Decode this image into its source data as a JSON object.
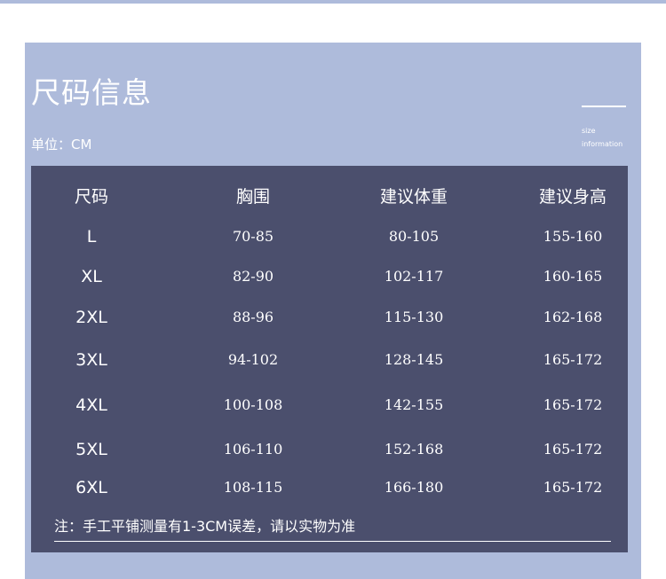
{
  "title": "尺码信息",
  "unit": "单位：CM",
  "deco": {
    "line1": "size",
    "line2": "information"
  },
  "table": {
    "headers": [
      "尺码",
      "胸围",
      "建议体重",
      "建议身高"
    ],
    "rows": [
      [
        "L",
        "70-85",
        "80-105",
        "155-160"
      ],
      [
        "XL",
        "82-90",
        "102-117",
        "160-165"
      ],
      [
        "2XL",
        "88-96",
        "115-130",
        "162-168"
      ],
      [
        "3XL",
        "94-102",
        "128-145",
        "165-172"
      ],
      [
        "4XL",
        "100-108",
        "142-155",
        "165-172"
      ],
      [
        "5XL",
        "106-110",
        "152-168",
        "165-172"
      ],
      [
        "6XL",
        "108-115",
        "166-180",
        "165-172"
      ]
    ]
  },
  "note": "注：手工平铺测量有1-3CM误差，请以实物为准"
}
